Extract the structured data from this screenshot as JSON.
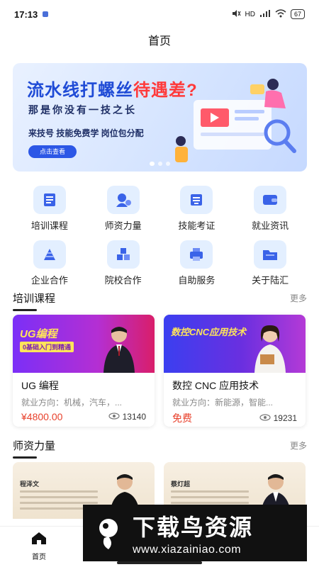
{
  "status": {
    "time": "17:13",
    "net": "HD",
    "battery": "67"
  },
  "header": {
    "title": "首页"
  },
  "banner": {
    "title_prefix": "流水线打螺丝",
    "title_highlight": "待遇差?",
    "subtitle": "那是你没有一技之长",
    "tagline": "来技号 技能免费学 岗位包分配",
    "button": "点击查看"
  },
  "menu": [
    {
      "label": "培训课程",
      "icon": "book-icon"
    },
    {
      "label": "师资力量",
      "icon": "teacher-icon"
    },
    {
      "label": "技能考证",
      "icon": "certificate-icon"
    },
    {
      "label": "就业资讯",
      "icon": "wallet-icon"
    },
    {
      "label": "企业合作",
      "icon": "pyramid-icon"
    },
    {
      "label": "院校合作",
      "icon": "cubes-icon"
    },
    {
      "label": "自助服务",
      "icon": "printer-icon"
    },
    {
      "label": "关于陆汇",
      "icon": "folder-icon"
    }
  ],
  "courses_section": {
    "title": "培训课程",
    "more": "更多"
  },
  "courses": [
    {
      "img_title": "UG编程",
      "img_sub": "0基础入门到精通",
      "title": "UG 编程",
      "desc": "就业方向：机械，汽车，...",
      "price": "¥4800.00",
      "views": "13140"
    },
    {
      "img_title": "数控CNC应用技术",
      "img_sub": "",
      "title": "数控 CNC 应用技术",
      "desc": "就业方向：新能源，智能...",
      "price": "免费",
      "views": "19231"
    }
  ],
  "teachers_section": {
    "title": "师资力量",
    "more": "更多"
  },
  "teachers": [
    {
      "name": "程泽文"
    },
    {
      "name": "蔡灯超"
    }
  ],
  "watermark": {
    "main": "下载鸟资源",
    "url": "www.xiazainiao.com"
  },
  "nav": {
    "home": "首页"
  },
  "colors": {
    "accent": "#2c57e6",
    "price": "#e8412c",
    "icon_bg": "#e3efff"
  }
}
